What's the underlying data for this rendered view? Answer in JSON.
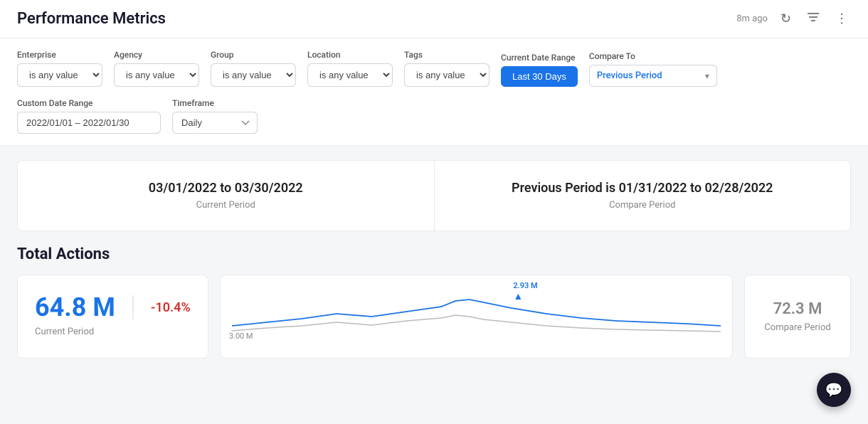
{
  "header": {
    "title": "Performance Metrics",
    "time_ago": "8m ago"
  },
  "icons": {
    "refresh": "↻",
    "filter": "⊟",
    "more": "⋮",
    "chevron_down": "▾",
    "chat": "💬"
  },
  "filters": {
    "enterprise_label": "Enterprise",
    "enterprise_value": "is any value",
    "agency_label": "Agency",
    "agency_value": "is any value",
    "group_label": "Group",
    "group_value": "is any value",
    "location_label": "Location",
    "location_value": "is any value",
    "tags_label": "Tags",
    "tags_value": "is any value",
    "current_date_range_label": "Current Date Range",
    "current_date_range_value": "Last 30 Days",
    "compare_to_label": "Compare To",
    "compare_to_value": "Previous Period",
    "custom_date_range_label": "Custom Date Range",
    "custom_date_range_value": "2022/01/01 – 2022/01/30",
    "timeframe_label": "Timeframe",
    "timeframe_value": "Daily"
  },
  "period_cards": {
    "current_date": "03/01/2022 to 03/30/2022",
    "current_label": "Current Period",
    "compare_date": "Previous Period is 01/31/2022 to 02/28/2022",
    "compare_label": "Compare Period"
  },
  "total_actions": {
    "section_title": "Total Actions",
    "current_value": "64.8 M",
    "current_label": "Current Period",
    "change_value": "-10.4%",
    "compare_value": "72.3 M",
    "compare_label": "Compare Period",
    "chart_y_label": "3.00 M",
    "chart_annotation": "2.93 M"
  }
}
